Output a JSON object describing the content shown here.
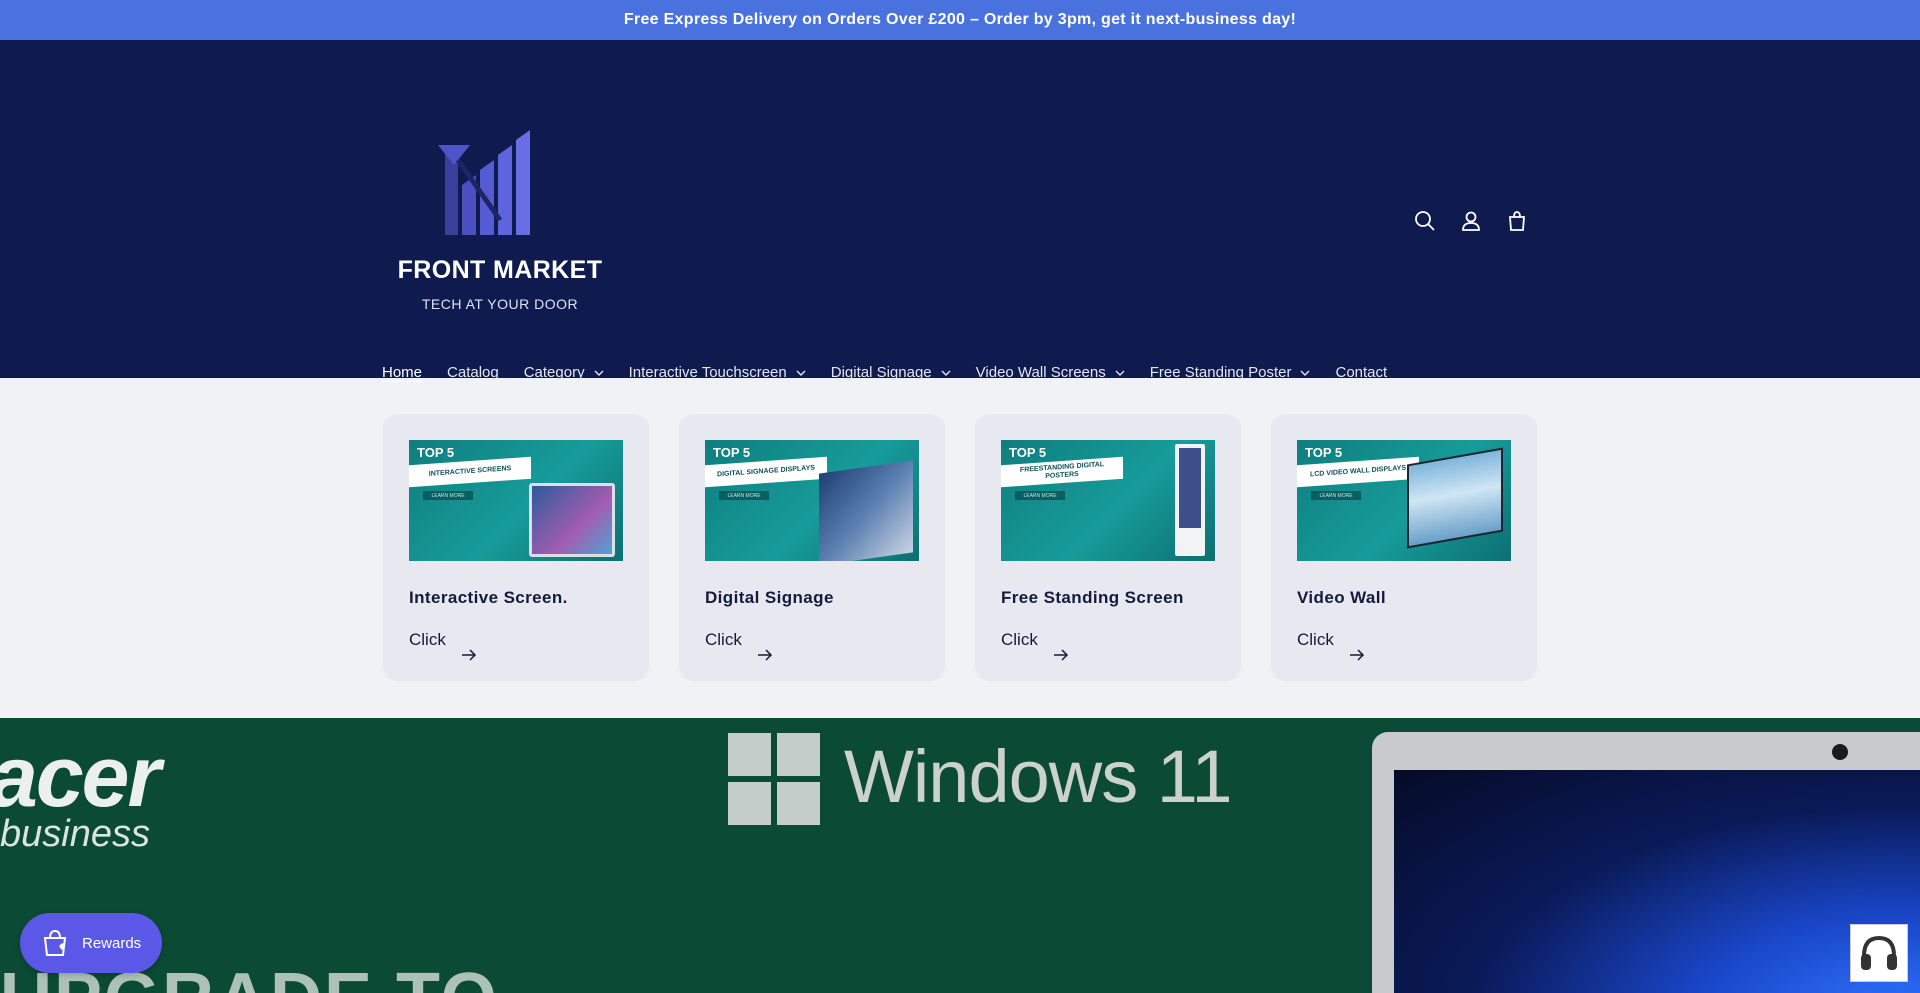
{
  "announcement": {
    "text": "Free Express Delivery on Orders Over £200 – Order by 3pm, get it next-business day!"
  },
  "logo": {
    "brand": "FRONT MARKET",
    "tagline": "TECH AT YOUR DOOR"
  },
  "header_icons": {
    "search": "search-icon",
    "account": "account-icon",
    "cart": "cart-icon"
  },
  "nav": {
    "items": [
      {
        "label": "Home",
        "active": true,
        "dropdown": false
      },
      {
        "label": "Catalog",
        "dropdown": false
      },
      {
        "label": "Category",
        "dropdown": true
      },
      {
        "label": "Interactive Touchscreen",
        "dropdown": true
      },
      {
        "label": "Digital Signage",
        "dropdown": true
      },
      {
        "label": "Video Wall Screens",
        "dropdown": true
      },
      {
        "label": "Free Standing Poster",
        "dropdown": true
      },
      {
        "label": "Contact",
        "dropdown": false
      }
    ]
  },
  "cards": [
    {
      "thumb_top": "TOP 5",
      "thumb_label": "INTERACTIVE SCREENS",
      "thumb_button": "LEARN MORE",
      "title": "Interactive Screen.",
      "link": "Click"
    },
    {
      "thumb_top": "TOP 5",
      "thumb_label": "DIGITAL SIGNAGE DISPLAYS",
      "thumb_button": "LEARN MORE",
      "title": "Digital Signage",
      "link": "Click"
    },
    {
      "thumb_top": "TOP 5",
      "thumb_label": "FREESTANDING DIGITAL POSTERS",
      "thumb_button": "LEARN MORE",
      "title": "Free Standing Screen",
      "link": "Click"
    },
    {
      "thumb_top": "TOP 5",
      "thumb_label": "LCD VIDEO WALL DISPLAYS",
      "thumb_button": "LEARN MORE",
      "title": "Video Wall",
      "link": "Click"
    }
  ],
  "banner": {
    "brand_text": "acer",
    "brand_sub": "business",
    "os_text": "Windows 11",
    "headline_partial": "UPGRADE TO"
  },
  "rewards": {
    "label": "Rewards"
  },
  "colors": {
    "announcement_bg": "#4a72de",
    "header_bg": "#0f1b4f",
    "rewards_bg": "#5b58e8",
    "banner_bg": "#0b4a34"
  }
}
